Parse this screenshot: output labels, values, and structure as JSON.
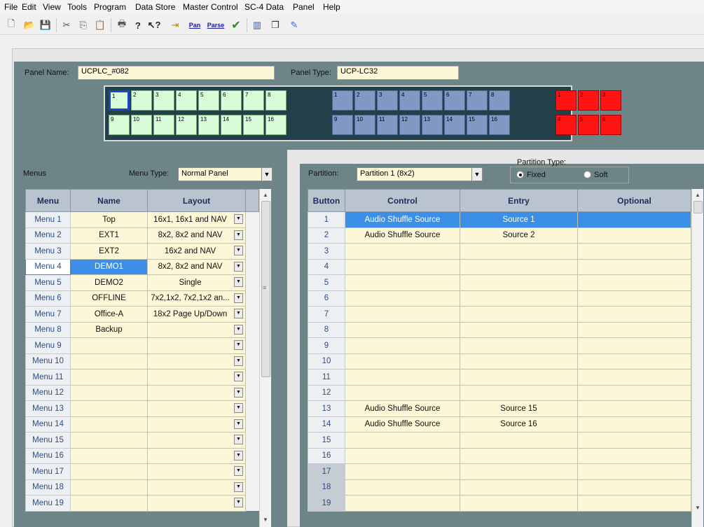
{
  "menubar": [
    "File",
    "Edit",
    "View",
    "Tools",
    "Program",
    "Data Store",
    "Master Control",
    "SC-4 Data",
    "Panel",
    "Help"
  ],
  "toolbar_icons": [
    "new-icon",
    "open-icon",
    "save-icon",
    "cut-icon",
    "copy-icon",
    "paste-icon",
    "print-icon",
    "help-icon",
    "context-help-icon",
    "import-icon",
    "pan-icon",
    "parse-icon",
    "check-icon",
    "columns-icon",
    "copy-window-icon",
    "edit-icon"
  ],
  "toolbar_texts": {
    "pan": "Pan",
    "parse": "Parse"
  },
  "panel": {
    "name_label": "Panel Name:",
    "name_value": "UCPLC_#082",
    "type_label": "Panel Type:",
    "type_value": "UCP-LC32"
  },
  "green_keys": [
    "1",
    "2",
    "3",
    "4",
    "5",
    "6",
    "7",
    "8",
    "9",
    "10",
    "11",
    "12",
    "13",
    "14",
    "15",
    "16"
  ],
  "blue_keys": [
    "1",
    "2",
    "3",
    "4",
    "5",
    "6",
    "7",
    "8",
    "9",
    "10",
    "11",
    "12",
    "13",
    "14",
    "15",
    "16"
  ],
  "red_keys": [
    "1",
    "2",
    "3",
    "4",
    "5",
    "6"
  ],
  "menus": {
    "label": "Menus",
    "type_label": "Menu Type:",
    "type_value": "Normal Panel",
    "headers": [
      "Menu",
      "Name",
      "Layout"
    ],
    "rows": [
      {
        "menu": "Menu 1",
        "name": "Top",
        "layout": "16x1, 16x1 and NAV"
      },
      {
        "menu": "Menu 2",
        "name": "EXT1",
        "layout": "8x2, 8x2 and NAV"
      },
      {
        "menu": "Menu 3",
        "name": "EXT2",
        "layout": "16x2 and NAV"
      },
      {
        "menu": "Menu 4",
        "name": "DEMO1",
        "layout": "8x2, 8x2 and NAV"
      },
      {
        "menu": "Menu 5",
        "name": "DEMO2",
        "layout": "Single"
      },
      {
        "menu": "Menu 6",
        "name": "OFFLINE",
        "layout": "7x2,1x2, 7x2,1x2 an..."
      },
      {
        "menu": "Menu 7",
        "name": "Office-A",
        "layout": "18x2 Page Up/Down"
      },
      {
        "menu": "Menu 8",
        "name": "Backup",
        "layout": ""
      },
      {
        "menu": "Menu 9",
        "name": "",
        "layout": ""
      },
      {
        "menu": "Menu 10",
        "name": "",
        "layout": ""
      },
      {
        "menu": "Menu 11",
        "name": "",
        "layout": ""
      },
      {
        "menu": "Menu 12",
        "name": "",
        "layout": ""
      },
      {
        "menu": "Menu 13",
        "name": "",
        "layout": ""
      },
      {
        "menu": "Menu 14",
        "name": "",
        "layout": ""
      },
      {
        "menu": "Menu 15",
        "name": "",
        "layout": ""
      },
      {
        "menu": "Menu 16",
        "name": "",
        "layout": ""
      },
      {
        "menu": "Menu 17",
        "name": "",
        "layout": ""
      },
      {
        "menu": "Menu 18",
        "name": "",
        "layout": ""
      },
      {
        "menu": "Menu 19",
        "name": "",
        "layout": ""
      }
    ]
  },
  "partition": {
    "label": "Partition:",
    "value": "Partition 1 (8x2)",
    "type_label": "Partition Type:",
    "fixed_label": "Fixed",
    "soft_label": "Soft",
    "headers": [
      "Button",
      "Control",
      "Entry",
      "Optional"
    ],
    "rows": [
      {
        "button": "1",
        "control": "Audio Shuffle Source",
        "entry": "Source 1",
        "optional": ""
      },
      {
        "button": "2",
        "control": "Audio Shuffle Source",
        "entry": "Source 2",
        "optional": ""
      },
      {
        "button": "3",
        "control": "",
        "entry": "",
        "optional": ""
      },
      {
        "button": "4",
        "control": "",
        "entry": "",
        "optional": ""
      },
      {
        "button": "5",
        "control": "",
        "entry": "",
        "optional": ""
      },
      {
        "button": "6",
        "control": "",
        "entry": "",
        "optional": ""
      },
      {
        "button": "7",
        "control": "",
        "entry": "",
        "optional": ""
      },
      {
        "button": "8",
        "control": "",
        "entry": "",
        "optional": ""
      },
      {
        "button": "9",
        "control": "",
        "entry": "",
        "optional": ""
      },
      {
        "button": "10",
        "control": "",
        "entry": "",
        "optional": ""
      },
      {
        "button": "11",
        "control": "",
        "entry": "",
        "optional": ""
      },
      {
        "button": "12",
        "control": "",
        "entry": "",
        "optional": ""
      },
      {
        "button": "13",
        "control": "Audio Shuffle Source",
        "entry": "Source 15",
        "optional": ""
      },
      {
        "button": "14",
        "control": "Audio Shuffle Source",
        "entry": "Source 16",
        "optional": ""
      },
      {
        "button": "15",
        "control": "",
        "entry": "",
        "optional": ""
      },
      {
        "button": "16",
        "control": "",
        "entry": "",
        "optional": ""
      },
      {
        "button": "17",
        "control": "",
        "entry": "",
        "optional": ""
      },
      {
        "button": "18",
        "control": "",
        "entry": "",
        "optional": ""
      },
      {
        "button": "19",
        "control": "",
        "entry": "",
        "optional": ""
      }
    ]
  },
  "colors": {
    "panel_bg": "#6e8588",
    "cell_bg": "#fcf7d6",
    "selection": "#3b8fe6",
    "green_key": "#d8fbd8",
    "blue_key": "#7f99c4",
    "red_key": "#ff1313"
  }
}
